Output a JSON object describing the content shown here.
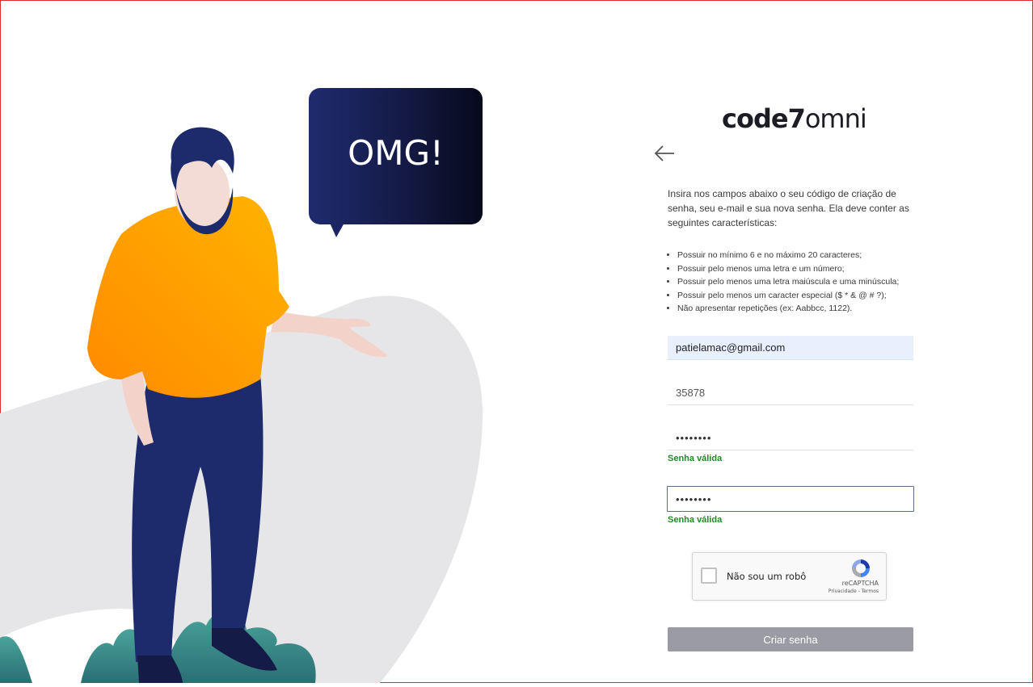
{
  "illustration": {
    "speech_bubble_text": "OMG!"
  },
  "logo": {
    "bold_part": "code7",
    "light_part": "omni"
  },
  "back_icon": "arrow-left-icon",
  "intro_text": "Insira nos campos abaixo o seu código de criação de senha, seu e-mail e sua nova senha. Ela deve conter as seguintes características:",
  "rules": [
    "Possuir no mínimo 6 e no máximo 20 caracteres;",
    "Possuir pelo menos uma letra e um número;",
    "Possuir pelo menos uma letra maiúscula e uma minúscula;",
    "Possuir pelo menos um caracter especial ($ * & @ # ?);",
    "Não apresentar repetições (ex: Aabbcc, 1122)."
  ],
  "form": {
    "email_value": "patielamac@gmail.com",
    "code_value": "35878",
    "password_value": "••••••••",
    "confirm_value": "••••••••",
    "password_status": "Senha válida",
    "confirm_status": "Senha válida",
    "submit_label": "Criar senha"
  },
  "recaptcha": {
    "label": "Não sou um robô",
    "brand": "reCAPTCHA",
    "privacy": "Privacidade",
    "separator": " - ",
    "terms": "Termos"
  },
  "colors": {
    "accent_valid": "#1e8a25",
    "button_disabled": "#9b9ba3",
    "bubble_dark": "#141a45",
    "shirt_orange": "#ffa200",
    "pants_navy": "#1d2a6b",
    "plant_teal": "#3a8a8a"
  }
}
